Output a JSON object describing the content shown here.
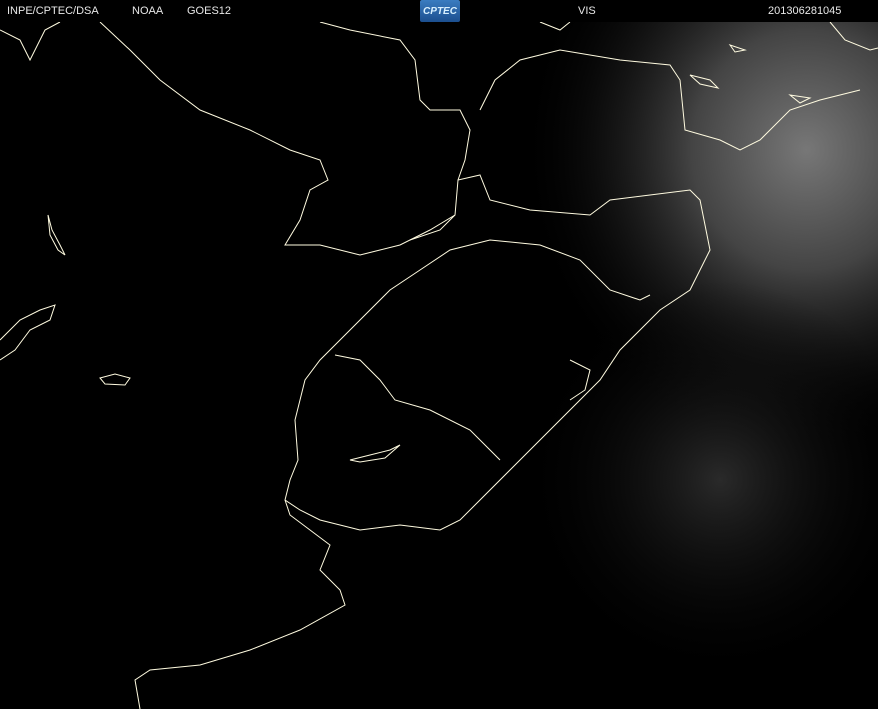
{
  "header": {
    "agency": "INPE/CPTEC/DSA",
    "provider": "NOAA",
    "satellite": "GOES12",
    "logo_text": "CPTEC",
    "channel": "VIS",
    "timestamp": "201306281045"
  },
  "colors": {
    "background": "#000000",
    "coastline": "#fffbe0",
    "text": "#e8e8e8"
  }
}
